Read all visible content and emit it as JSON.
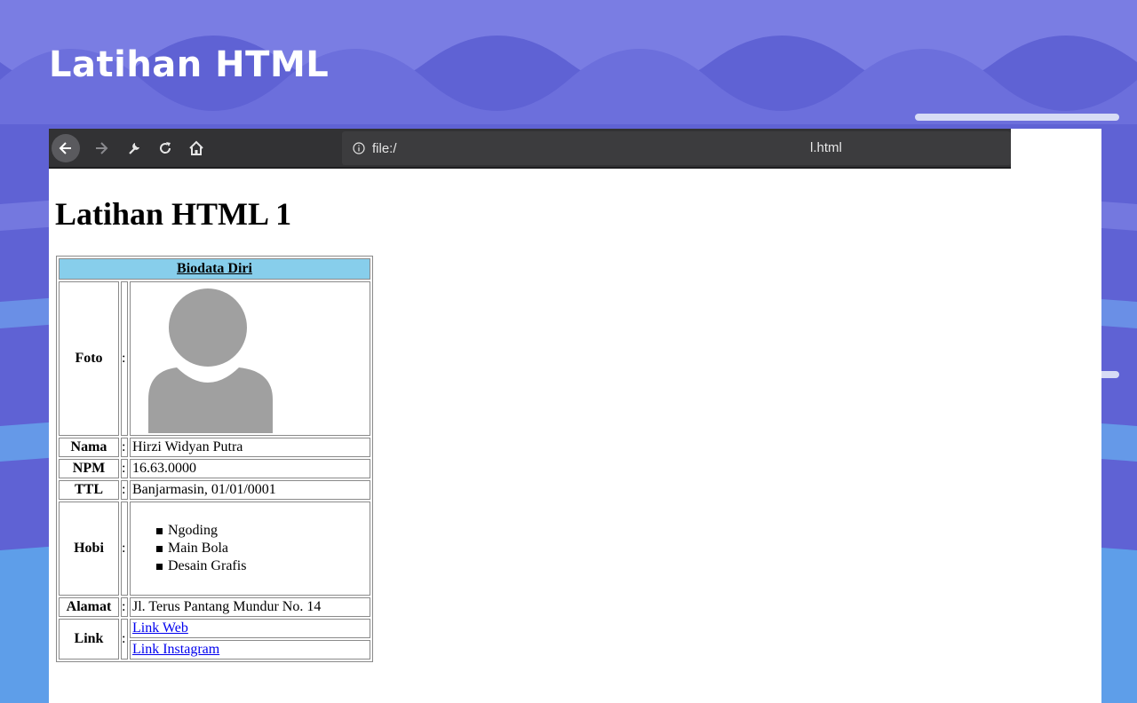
{
  "slide": {
    "title": "Latihan HTML"
  },
  "browser": {
    "url_scheme": "file:/",
    "url_file": "l.html",
    "icons": [
      "back-icon",
      "forward-icon",
      "tools-icon",
      "reload-icon",
      "home-icon",
      "info-icon"
    ]
  },
  "page": {
    "heading": "Latihan HTML 1",
    "table": {
      "header": "Biodata Diri",
      "colon": ":",
      "rows": {
        "foto": {
          "label": "Foto"
        },
        "nama": {
          "label": "Nama",
          "value": "Hirzi Widyan Putra"
        },
        "npm": {
          "label": "NPM",
          "value": "16.63.0000"
        },
        "ttl": {
          "label": "TTL",
          "value": "Banjarmasin, 01/01/0001"
        },
        "hobi": {
          "label": "Hobi",
          "items": [
            "Ngoding",
            "Main Bola",
            "Desain Grafis"
          ]
        },
        "alamat": {
          "label": "Alamat",
          "value": "Jl. Terus Pantang Mundur No. 14"
        },
        "link": {
          "label": "Link",
          "links": [
            "Link Web",
            "Link Instagram"
          ]
        }
      }
    }
  },
  "colors": {
    "table_header_bg": "#87ceeb",
    "toolbar_bg": "#323234",
    "slide_bg": "#5f62d4",
    "link": "#0000ee"
  }
}
